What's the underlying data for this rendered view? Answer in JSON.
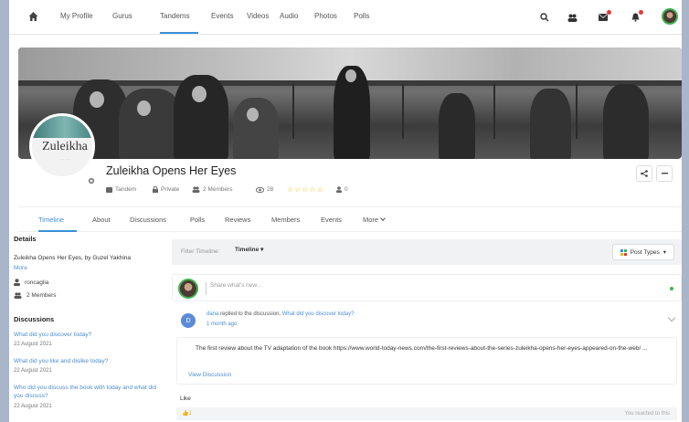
{
  "nav": {
    "links": [
      "My Profile",
      "Gurus",
      "Tandems",
      "Events",
      "Videos",
      "Audio",
      "Photos",
      "Polls"
    ]
  },
  "group": {
    "cover_title": "Zuleikha",
    "title": "Zuleikha Opens Her Eyes",
    "type": "Tandem",
    "privacy": "Private",
    "members": "2 Members",
    "views": "28",
    "rating": "0"
  },
  "tabs": [
    "Timeline",
    "About",
    "Discussions",
    "Polls",
    "Reviews",
    "Members",
    "Events",
    "More"
  ],
  "sidebar": {
    "details_heading": "Details",
    "description": "Zuleikha Opens Her Eyes, by Guzel Yakhina",
    "more": "More",
    "organizer": "roncaglia",
    "members": "2 Members",
    "discussions_heading": "Discussions",
    "discussions": [
      {
        "title": "What did you discover today?",
        "date": "22 August 2021"
      },
      {
        "title": "What did you like and dislike today?",
        "date": "22 August 2021"
      },
      {
        "title": "Who did you discuss the book with today and what did you discuss?",
        "date": "22 August 2021"
      }
    ]
  },
  "feed": {
    "filter_label": "Filter Timeline:",
    "filter_value": "Timeline",
    "post_types": "Post Types",
    "post_placeholder": "Share what's new...",
    "activity": {
      "avatar_letter": "D",
      "user": "dana",
      "action": "replied to the discussion,",
      "discussion": "What did you discover today?",
      "time": "1 month ago",
      "text": "The first review about the TV adaptation of the book https://www.world-today-news.com/the-first-reviews-about-the-series-zuleikha-opens-her-eyes-appeared-on-the-web/ ...",
      "view_link": "View Discussion",
      "like_label": "Like",
      "like_count": "1",
      "reacted": "You reacted to this"
    }
  }
}
